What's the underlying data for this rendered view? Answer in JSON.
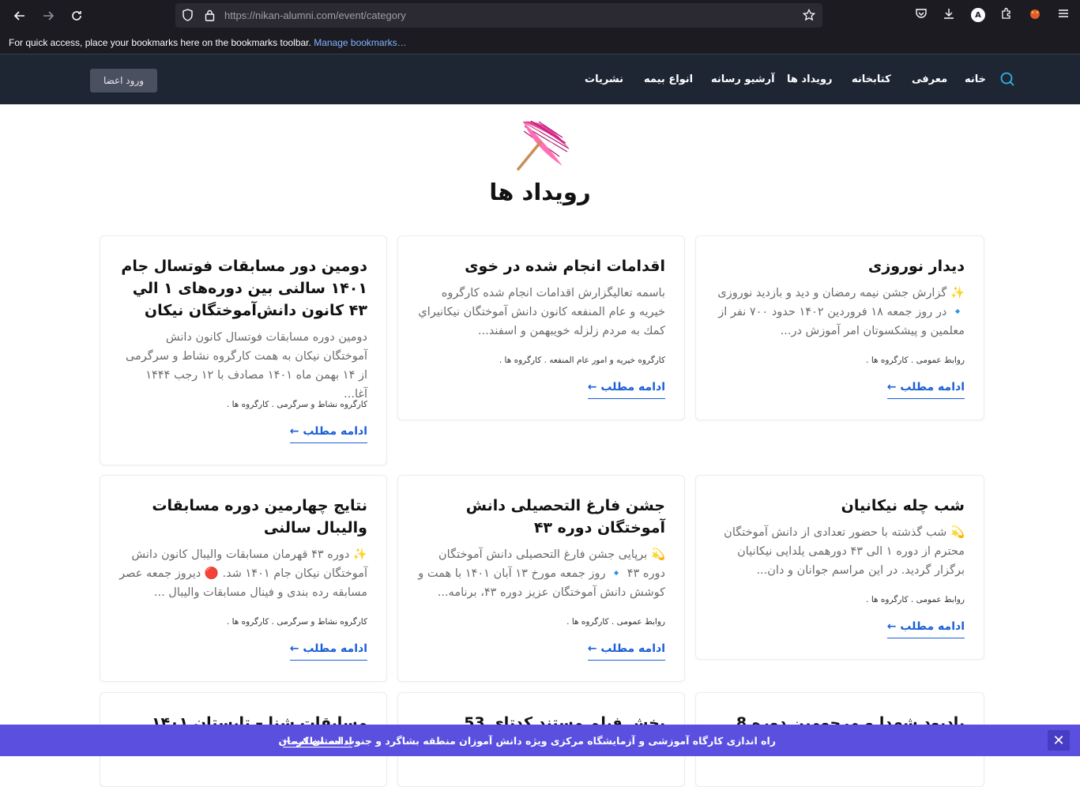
{
  "browser": {
    "url": "https://nikan-alumni.com/event/category",
    "bookmarks_hint": "For quick access, place your bookmarks here on the bookmarks toolbar.",
    "manage_bookmarks": "Manage bookmarks…",
    "profile_letter": "A"
  },
  "site": {
    "login_label": "ورود اعضا",
    "menu": [
      "خانه",
      "معرفی",
      "کتابخانه",
      "رویداد ها",
      "آرشیو رسانه",
      "انواع بیمه",
      "نشریات"
    ],
    "page_title": "رویداد ها"
  },
  "cards": [
    {
      "title": "دیدار نوروزی",
      "excerpt": "✨ گزارش جشن نیمه رمضان و دید و بازدید نوروزی 🔹 در روز جمعه ۱۸ فروردین ۱۴۰۲ حدود ۷۰۰ نفر از معلمین و پیشکسوتان امر آموزش در...",
      "meta": "روابط عمومی . کارگروه ها .",
      "more": "ادامه مطلب ←"
    },
    {
      "title": "اقدامات انجام شده در خوی",
      "excerpt": "باسمه تعالیگزارش اقدامات انجام شده کارگروه خیریه و عام المنفعه کانون دانش آموختگان نیکانيراي کمك به مردم زلزله خويبهمن و اسفند...",
      "meta": "کارگروه خیریه و امور عام المنفعه . کارگروه ها .",
      "more": "ادامه مطلب ←"
    },
    {
      "title": "دومین دور مسابقات فوتسال جام ۱۴۰۱ سالنی بین دوره‌های ۱ الي ۴۳ کانون دانش‌آموختگان نیکان",
      "excerpt": "دومین دوره مسابقات فوتسال کانون دانش آموختگان نیکان به همت کارگروه نشاط و سرگرمی از ۱۴ بهمن ماه ۱۴۰۱ مصادف با ۱۲ رجب ۱۴۴۴ آغا...",
      "meta": "کارگروه نشاط و سرگرمی . کارگروه ها .",
      "more": "ادامه مطلب ←"
    },
    {
      "title": "شب چله نیکانیان",
      "excerpt": "💫 شب گذشته با حضور تعدادی از دانش آموختگان محترم از دوره ۱ الی ۴۳ دورهمی یلدایی نیکانیان برگزار گردید. در این مراسم جوانان و دان...",
      "meta": "روابط عمومی . کارگروه ها .",
      "more": "ادامه مطلب ←"
    },
    {
      "title": "جشن فارغ التحصیلی دانش آموختگان دوره ۴۳",
      "excerpt": "💫 برپایی جشن فارغ التحصیلی دانش آموختگان دوره ۴۳ 🔹 روز جمعه مورخ ۱۳ آبان ۱۴۰۱ با همت و کوشش دانش آموختگان عزیز دوره ۴۳، برنامه...",
      "meta": "روابط عمومی . کارگروه ها .",
      "more": "ادامه مطلب ←"
    },
    {
      "title": "نتایج چهارمین دوره مسابقات والیبال سالنی",
      "excerpt": "✨ دوره ۴۳ قهرمان مسابقات والیبال کانون دانش آموختگان نیکان جام ۱۴۰۱ شد. 🔴 دیروز جمعه عصر مسابقه رده بندی و فینال مسابقات والیبال ...",
      "meta": "کارگروه نشاط و سرگرمی . کارگروه ها .",
      "more": "ادامه مطلب ←"
    },
    {
      "title": "یادبود شهدا و مرحومین دوره 8"
    },
    {
      "title": "پخش فیلم مستند کدتای 53"
    },
    {
      "title": "مسابقات شنا – تابستان ۱۴۰۱"
    }
  ],
  "notice": {
    "text": "راه اندازی کارگاه آموزشی و آزمایشگاه مرکزی ویژه دانش آموزان منطقه بشاگرد و جنوب استان کرمان",
    "more": "ادامه مطلب ←",
    "close": "✕"
  },
  "colors": {
    "header_bg": "#1e2533",
    "link": "#1a5fd6",
    "notice_bg": "#5b4fe0"
  }
}
